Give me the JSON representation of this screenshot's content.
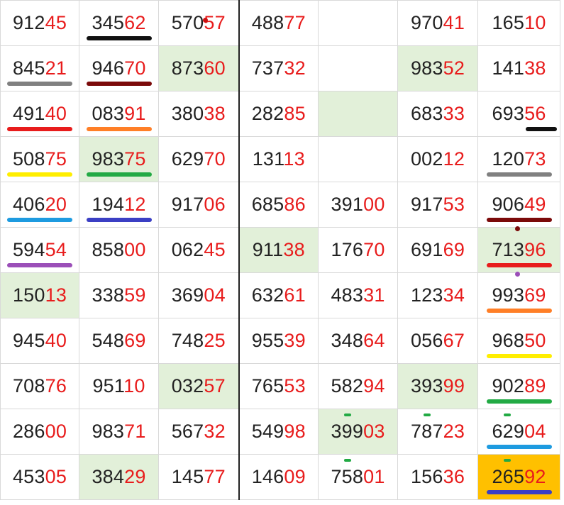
{
  "columns": 7,
  "divider_after_column": 2,
  "colors": {
    "text_lead": "#222222",
    "text_tail": "#e81c1c",
    "highlight_green": "#e2f0d9",
    "highlight_orange": "#ffc000",
    "grid": "#d9d9d9"
  },
  "rows": [
    [
      {
        "lead": "912",
        "tail": "45"
      },
      {
        "lead": "345",
        "tail": "62",
        "u": "#111111"
      },
      {
        "lead": "570",
        "tail": "57",
        "dot": "#cc1111"
      },
      {
        "lead": "488",
        "tail": "77"
      },
      {
        "lead": "",
        "tail": ""
      },
      {
        "lead": "970",
        "tail": "41"
      },
      {
        "lead": "165",
        "tail": "10"
      }
    ],
    [
      {
        "lead": "845",
        "tail": "21",
        "u": "#808080"
      },
      {
        "lead": "946",
        "tail": "70",
        "u": "#7b0a0a"
      },
      {
        "lead": "873",
        "tail": "60",
        "bg": "green"
      },
      {
        "lead": "737",
        "tail": "32"
      },
      {
        "lead": "",
        "tail": ""
      },
      {
        "lead": "983",
        "tail": "52",
        "bg": "green"
      },
      {
        "lead": "141",
        "tail": "38"
      }
    ],
    [
      {
        "lead": "491",
        "tail": "40",
        "u": "#e81c1c"
      },
      {
        "lead": "083",
        "tail": "91",
        "u": "#ff7f27"
      },
      {
        "lead": "380",
        "tail": "38"
      },
      {
        "lead": "282",
        "tail": "85"
      },
      {
        "lead": "",
        "tail": "",
        "bg": "green"
      },
      {
        "lead": "683",
        "tail": "33"
      },
      {
        "lead": "693",
        "tail": "56",
        "u": "#111111",
        "ushift": "right"
      }
    ],
    [
      {
        "lead": "508",
        "tail": "75",
        "u": "#ffee00"
      },
      {
        "lead": "983",
        "tail": "75",
        "bg": "green",
        "u": "#22aa44"
      },
      {
        "lead": "629",
        "tail": "70"
      },
      {
        "lead": "131",
        "tail": "13"
      },
      {
        "lead": "",
        "tail": ""
      },
      {
        "lead": "002",
        "tail": "12"
      },
      {
        "lead": "120",
        "tail": "73",
        "u": "#808080"
      }
    ],
    [
      {
        "lead": "406",
        "tail": "20",
        "u": "#1e9be0"
      },
      {
        "lead": "194",
        "tail": "12",
        "u": "#3b3fc4"
      },
      {
        "lead": "917",
        "tail": "06"
      },
      {
        "lead": "685",
        "tail": "86"
      },
      {
        "lead": "391",
        "tail": "00"
      },
      {
        "lead": "917",
        "tail": "53"
      },
      {
        "lead": "906",
        "tail": "49",
        "u": "#7b0a0a"
      }
    ],
    [
      {
        "lead": "594",
        "tail": "54",
        "u": "#9b4fb8"
      },
      {
        "lead": "858",
        "tail": "00"
      },
      {
        "lead": "062",
        "tail": "45"
      },
      {
        "lead": "911",
        "tail": "38",
        "bg": "green"
      },
      {
        "lead": "176",
        "tail": "70"
      },
      {
        "lead": "691",
        "tail": "69"
      },
      {
        "lead": "713",
        "tail": "96",
        "bg": "green",
        "u": "#e81c1c",
        "topdot": "#7b0a0a"
      }
    ],
    [
      {
        "lead": "150",
        "tail": "13",
        "bg": "green"
      },
      {
        "lead": "338",
        "tail": "59"
      },
      {
        "lead": "369",
        "tail": "04"
      },
      {
        "lead": "632",
        "tail": "61"
      },
      {
        "lead": "483",
        "tail": "31"
      },
      {
        "lead": "123",
        "tail": "34"
      },
      {
        "lead": "993",
        "tail": "69",
        "u": "#ff7f27",
        "topdot": "#9b4fb8"
      }
    ],
    [
      {
        "lead": "945",
        "tail": "40"
      },
      {
        "lead": "548",
        "tail": "69"
      },
      {
        "lead": "748",
        "tail": "25"
      },
      {
        "lead": "955",
        "tail": "39"
      },
      {
        "lead": "348",
        "tail": "64"
      },
      {
        "lead": "056",
        "tail": "67"
      },
      {
        "lead": "968",
        "tail": "50",
        "u": "#ffee00"
      }
    ],
    [
      {
        "lead": "708",
        "tail": "76"
      },
      {
        "lead": "951",
        "tail": "10"
      },
      {
        "lead": "032",
        "tail": "57",
        "bg": "green"
      },
      {
        "lead": "765",
        "tail": "53"
      },
      {
        "lead": "582",
        "tail": "94"
      },
      {
        "lead": "393",
        "tail": "99",
        "bg": "green"
      },
      {
        "lead": "902",
        "tail": "89",
        "u": "#22aa44"
      }
    ],
    [
      {
        "lead": "286",
        "tail": "00"
      },
      {
        "lead": "983",
        "tail": "71"
      },
      {
        "lead": "567",
        "tail": "32"
      },
      {
        "lead": "549",
        "tail": "98"
      },
      {
        "lead": "399",
        "tail": "03",
        "bg": "green",
        "greenmarks": true
      },
      {
        "lead": "787",
        "tail": "23",
        "greenmarks": true
      },
      {
        "lead": "629",
        "tail": "04",
        "u": "#1e9be0",
        "greenmarks": true
      }
    ],
    [
      {
        "lead": "453",
        "tail": "05"
      },
      {
        "lead": "384",
        "tail": "29",
        "bg": "green"
      },
      {
        "lead": "145",
        "tail": "77"
      },
      {
        "lead": "146",
        "tail": "09"
      },
      {
        "lead": "758",
        "tail": "01",
        "greenmarks": true
      },
      {
        "lead": "156",
        "tail": "36"
      },
      {
        "lead": "265",
        "tail": "92",
        "bg": "orange",
        "u": "#3b3fc4",
        "greenmarks": true
      }
    ]
  ]
}
